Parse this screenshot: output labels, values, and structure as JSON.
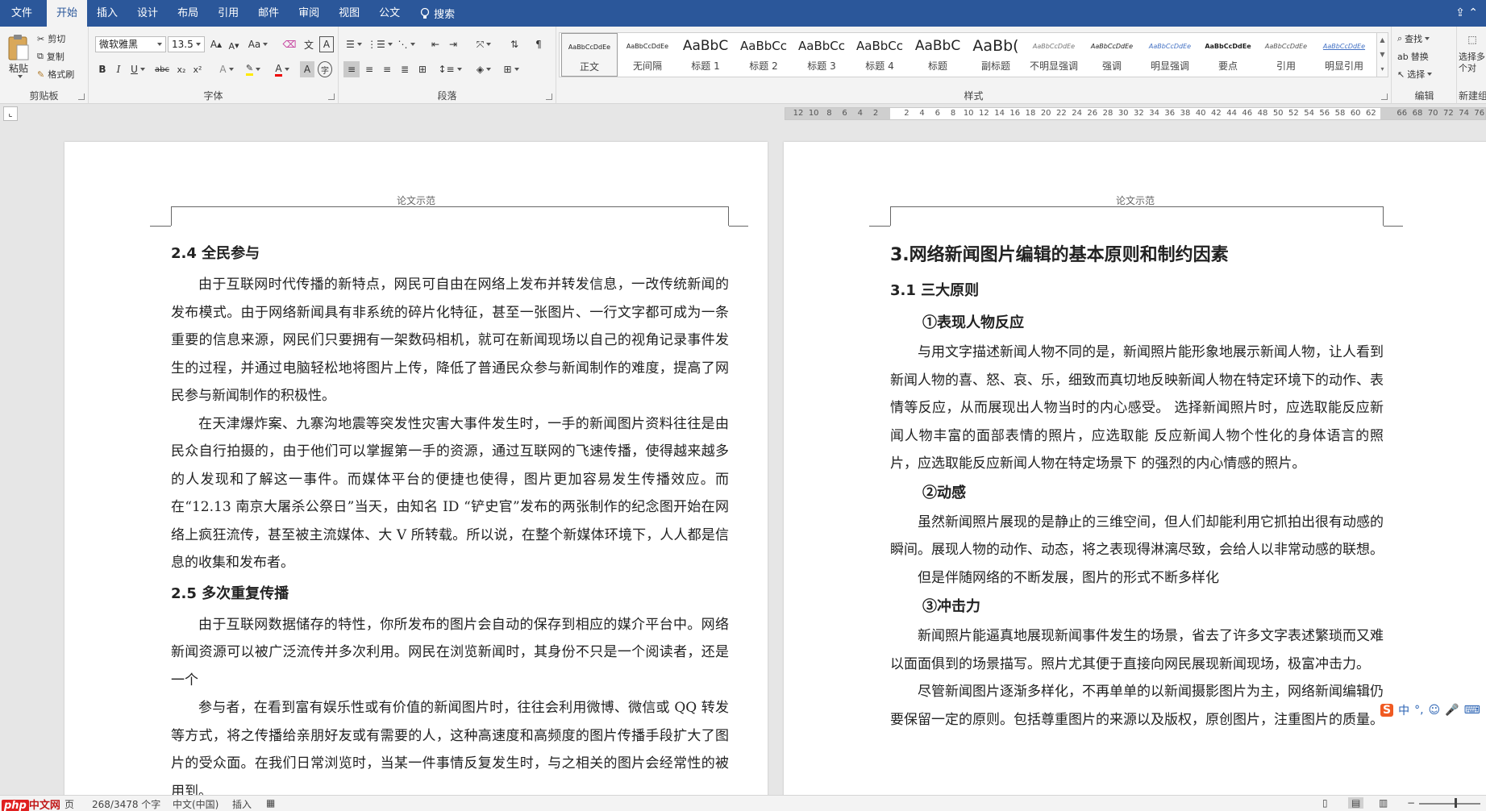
{
  "tabs": [
    "文件",
    "开始",
    "插入",
    "设计",
    "布局",
    "引用",
    "邮件",
    "审阅",
    "视图",
    "公文"
  ],
  "active_tab": "开始",
  "search_label": "搜索",
  "clipboard": {
    "label": "剪贴板",
    "paste": "粘贴",
    "cut": "剪切",
    "copy": "复制",
    "format_painter": "格式刷"
  },
  "font": {
    "label": "字体",
    "font_name": "微软雅黑",
    "font_size": "13.5",
    "increase": "A",
    "decrease": "A",
    "case": "Aa",
    "bold": "B",
    "italic": "I",
    "underline": "U",
    "strike": "abc",
    "sub": "x₂",
    "sup": "x²",
    "clear": "A",
    "highlight": "aby",
    "color": "A",
    "char_shade": "A",
    "enclose": "字"
  },
  "paragraph": {
    "label": "段落"
  },
  "styles": {
    "label": "样式",
    "items": [
      {
        "sample": "AaBbCcDdEe",
        "name": "正文"
      },
      {
        "sample": "AaBbCcDdEe",
        "name": "无间隔"
      },
      {
        "sample": "AaBbC",
        "name": "标题 1"
      },
      {
        "sample": "AaBbCc",
        "name": "标题 2"
      },
      {
        "sample": "AaBbCc",
        "name": "标题 3"
      },
      {
        "sample": "AaBbCc",
        "name": "标题 4"
      },
      {
        "sample": "AaBbC",
        "name": "标题"
      },
      {
        "sample": "AaBb(",
        "name": "副标题"
      },
      {
        "sample": "AaBbCcDdEe",
        "name": "不明显强调"
      },
      {
        "sample": "AaBbCcDdEe",
        "name": "强调"
      },
      {
        "sample": "AaBbCcDdEe",
        "name": "明显强调"
      },
      {
        "sample": "AaBbCcDdEe",
        "name": "要点"
      },
      {
        "sample": "AaBbCcDdEe",
        "name": "引用"
      },
      {
        "sample": "AaBbCcDdEe",
        "name": "明显引用"
      }
    ]
  },
  "editing": {
    "label": "编辑",
    "find": "查找",
    "replace": "替换",
    "select": "选择"
  },
  "new_group": {
    "label": "新建组",
    "select_multi": "选择多个对"
  },
  "ruler_numbers": [
    "12",
    "10",
    "8",
    "6",
    "4",
    "2",
    "",
    "2",
    "4",
    "6",
    "8",
    "10",
    "12",
    "14",
    "16",
    "18",
    "20",
    "22",
    "24",
    "26",
    "28",
    "30",
    "32",
    "34",
    "36",
    "38",
    "40",
    "42",
    "44",
    "46",
    "48",
    "50",
    "52",
    "54",
    "56",
    "58",
    "60",
    "62",
    "",
    "66",
    "68",
    "70",
    "72",
    "74",
    "76"
  ],
  "page_left": {
    "header": "论文示范",
    "blocks": [
      {
        "type": "h2",
        "text": "2.4 全民参与"
      },
      {
        "type": "p",
        "text": "由于互联网时代传播的新特点，网民可自由在网络上发布并转发信息，一改传统新闻的发布模式。由于网络新闻具有非系统的碎片化特征，甚至一张图片、一行文字都可成为一条重要的信息来源，网民们只要拥有一架数码相机，就可在新闻现场以自己的视角记录事件发生的过程，并通过电脑轻松地将图片上传，降低了普通民众参与新闻制作的难度，提高了网民参与新闻制作的积极性。"
      },
      {
        "type": "p",
        "text": "在天津爆炸案、九寨沟地震等突发性灾害大事件发生时，一手的新闻图片资料往往是由民众自行拍摄的，由于他们可以掌握第一手的资源，通过互联网的飞速传播，使得越来越多的人发现和了解这一事件。而媒体平台的便捷也使得，图片更加容易发生传播效应。而在“12.13 南京大屠杀公祭日”当天，由知名 ID “铲史官”发布的两张制作的纪念图开始在网络上疯狂流传，甚至被主流媒体、大 V 所转载。所以说，在整个新媒体环境下，人人都是信息的收集和发布者。"
      },
      {
        "type": "h2",
        "text": "2.5 多次重复传播"
      },
      {
        "type": "p",
        "text": "由于互联网数据储存的特性，你所发布的图片会自动的保存到相应的媒介平台中。网络新闻资源可以被广泛流传并多次利用。网民在浏览新闻时，其身份不只是一个阅读者，还是一个"
      },
      {
        "type": "p",
        "text": "参与者，在看到富有娱乐性或有价值的新闻图片时，往往会利用微博、微信或 QQ 转发等方式，将之传播给亲朋好友或有需要的人，这种高速度和高频度的图片传播手段扩大了图片的受众面。在我们日常浏览时，当某一件事情反复发生时，与之相关的图片会经常性的被用到。"
      }
    ]
  },
  "page_right": {
    "header": "论文示范",
    "blocks": [
      {
        "type": "h1",
        "text": "3.网络新闻图片编辑的基本原则和制约因素"
      },
      {
        "type": "h2",
        "text": "3.1 三大原则"
      },
      {
        "type": "h3",
        "text": "①表现人物反应"
      },
      {
        "type": "p",
        "text": "与用文字描述新闻人物不同的是，新闻照片能形象地展示新闻人物，让人看到新闻人物的喜、怒、哀、乐，细致而真切地反映新闻人物在特定环境下的动作、表情等反应，从而展现出人物当时的内心感受。 选择新闻照片时，应选取能反应新闻人物丰富的面部表情的照片，应选取能 反应新闻人物个性化的身体语言的照片，应选取能反应新闻人物在特定场景下 的强烈的内心情感的照片。"
      },
      {
        "type": "h3",
        "text": "②动感"
      },
      {
        "type": "p",
        "text": "虽然新闻照片展现的是静止的三维空间，但人们却能利用它抓拍出很有动感的瞬间。展现人物的动作、动态，将之表现得淋漓尽致，会给人以非常动感的联想。"
      },
      {
        "type": "p",
        "text": "但是伴随网络的不断发展，图片的形式不断多样化"
      },
      {
        "type": "h3",
        "text": "③冲击力"
      },
      {
        "type": "p",
        "text": " 新闻照片能逼真地展现新闻事件发生的场景，省去了许多文字表述繁琐而又难以面面俱到的场景描写。照片尤其便于直接向网民展现新闻现场，极富冲击力。"
      },
      {
        "type": "p",
        "text": "尽管新闻图片逐渐多样化，不再单单的以新闻摄影图片为主，网络新闻编辑仍要保留一定的原则。包括尊重图片的来源以及版权，原创图片，注重图片的质量。"
      }
    ]
  },
  "status": {
    "page_suffix": "页",
    "words": "268/3478 个字",
    "language": "中文(中国)",
    "mode": "插入"
  },
  "ime": {
    "s": "S",
    "lang": "中",
    "punct": "°,"
  },
  "logo": {
    "php": "php",
    "cn": "中文网"
  }
}
